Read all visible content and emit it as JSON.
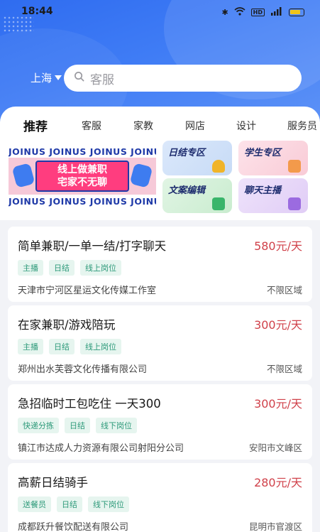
{
  "statusbar": {
    "time": "18:44",
    "battery_color": "#f0c419"
  },
  "header": {
    "city": "上海",
    "search_placeholder": "客服"
  },
  "tabs": [
    "推荐",
    "客服",
    "家教",
    "网店",
    "设计",
    "服务员"
  ],
  "banner": {
    "strip_text": "JOINUS JOINUS JOINUS JOINUS",
    "line1": "线上做兼职",
    "line2": "宅家不无聊"
  },
  "tiles": [
    "日结专区",
    "学生专区",
    "文案编辑",
    "聊天主播"
  ],
  "jobs": [
    {
      "title": "简单兼职/一单一结/打字聊天",
      "salary": "580元/天",
      "tags": [
        "主播",
        "日结",
        "线上岗位"
      ],
      "company": "天津市宁河区星运文化传媒工作室",
      "region": "不限区域"
    },
    {
      "title": "在家兼职/游戏陪玩",
      "salary": "300元/天",
      "tags": [
        "主播",
        "日结",
        "线上岗位"
      ],
      "company": "郑州出水芙蓉文化传播有限公司",
      "region": "不限区域"
    },
    {
      "title": "急招临时工包吃住 一天300",
      "salary": "300元/天",
      "tags": [
        "快递分拣",
        "日结",
        "线下岗位"
      ],
      "company": "镇江市达成人力资源有限公司射阳分公司",
      "region": "安阳市文峰区"
    },
    {
      "title": "高薪日结骑手",
      "salary": "280元/天",
      "tags": [
        "送餐员",
        "日结",
        "线下岗位"
      ],
      "company": "成都跃升餐饮配送有限公司",
      "region": "昆明市官渡区"
    }
  ],
  "colors": {
    "brand_blue": "#2f6cf0",
    "salary_red": "#d0414a",
    "tag_green": "#2e9a7a"
  }
}
